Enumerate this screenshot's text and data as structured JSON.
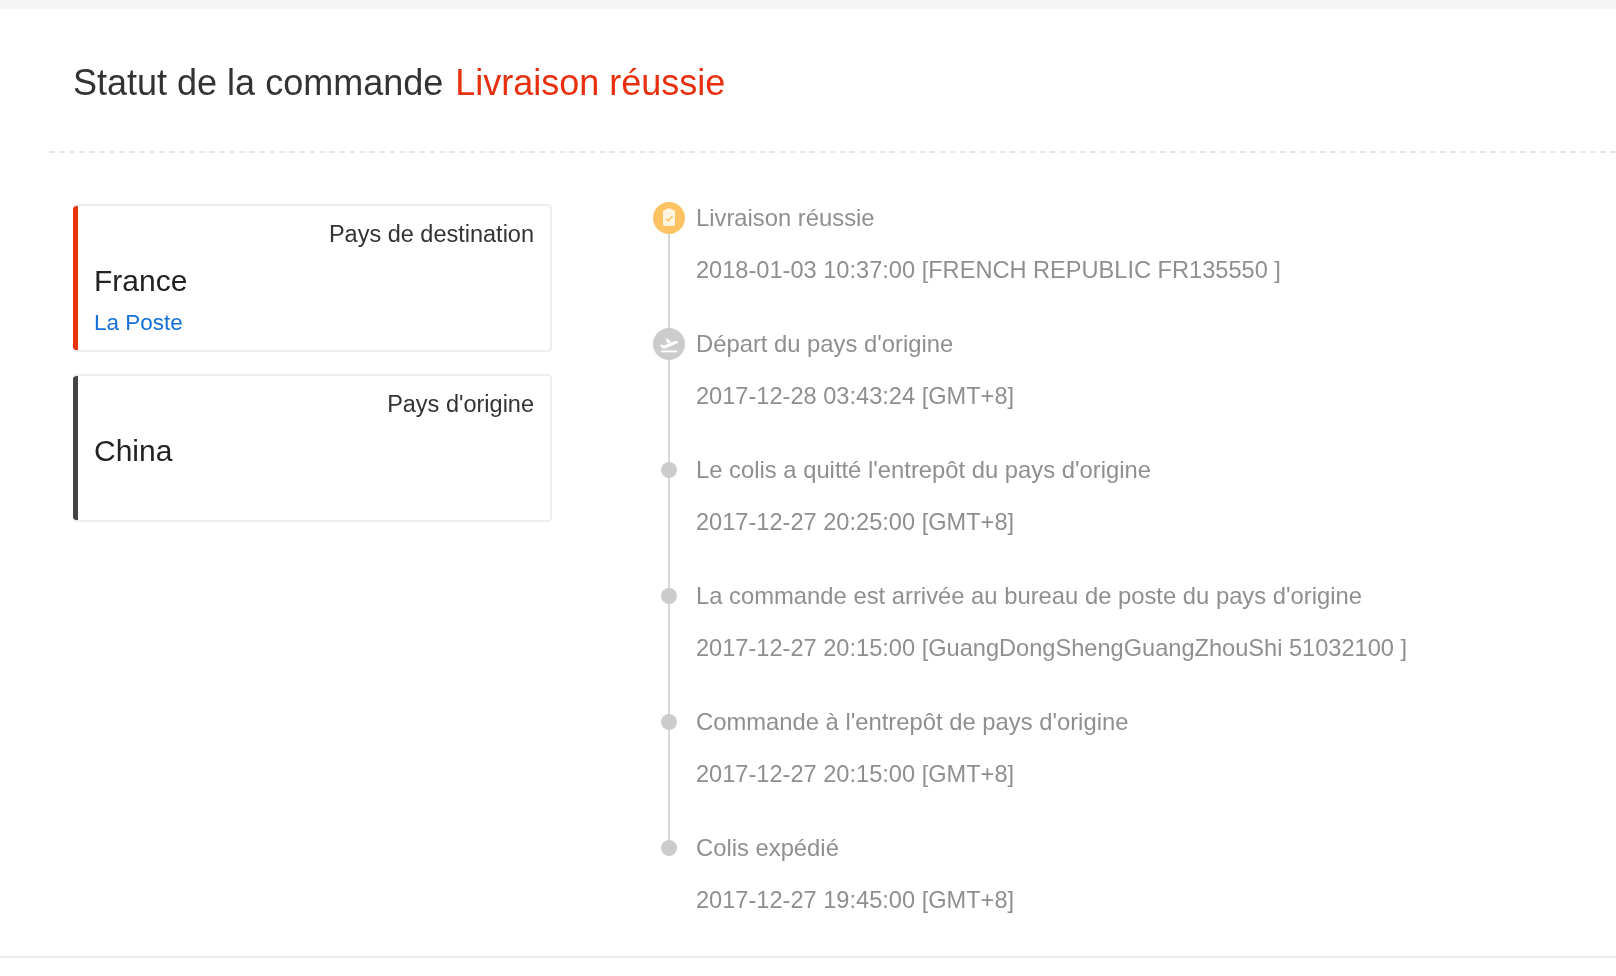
{
  "order_status": {
    "label": "Statut de la commande",
    "value": "Livraison réussie"
  },
  "countries": [
    {
      "label": "Pays de destination",
      "country": "France",
      "carrier": "La Poste",
      "color": "#e8340c"
    },
    {
      "label": "Pays d'origine",
      "country": "China",
      "color": "#444444"
    }
  ],
  "events": [
    {
      "kind": "delivered",
      "title": "Livraison réussie",
      "detail": "2018-01-03 10:37:00 [FRENCH REPUBLIC FR135550 ]"
    },
    {
      "kind": "departure",
      "title": "Départ du pays d'origine",
      "detail": "2017-12-28 03:43:24 [GMT+8]"
    },
    {
      "kind": "step",
      "title": "Le colis a quitté l'entrepôt du pays d'origine",
      "detail": "2017-12-27 20:25:00 [GMT+8]"
    },
    {
      "kind": "step",
      "title": "La commande est arrivée au bureau de poste du pays d'origine",
      "detail": "2017-12-27 20:15:00 [GuangDongShengGuangZhouShi 51032100 ]"
    },
    {
      "kind": "step",
      "title": "Commande à l'entrepôt de pays d'origine",
      "detail": "2017-12-27 20:15:00 [GMT+8]"
    },
    {
      "kind": "step",
      "title": "Colis expédié",
      "detail": "2017-12-27 19:45:00 [GMT+8]"
    }
  ]
}
